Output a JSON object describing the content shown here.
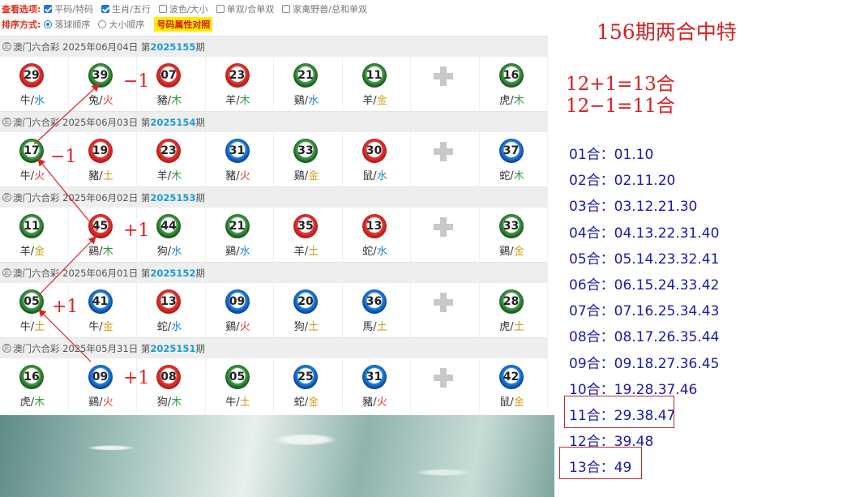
{
  "options": {
    "view_label": "查看选项:",
    "view_items": [
      {
        "label": "平码/特码",
        "checked": true
      },
      {
        "label": "生肖/五行",
        "checked": true
      },
      {
        "label": "波色/大小",
        "checked": false
      },
      {
        "label": "单双/合单双",
        "checked": false
      },
      {
        "label": "家禽野兽/总和单双",
        "checked": false
      }
    ],
    "sort_label": "排序方式:",
    "sort_items": [
      {
        "label": "落球顺序",
        "selected": true
      },
      {
        "label": "大小顺序",
        "selected": false
      }
    ],
    "highlight_button": "号码属性对照"
  },
  "draws": [
    {
      "prefix": "澳门六合彩 2025年06月04日 第",
      "issue": "2025155",
      "suffix": "期",
      "balls": [
        {
          "num": "29",
          "color": "red",
          "zodiac": "牛",
          "element": "水",
          "el": "water"
        },
        {
          "num": "39",
          "color": "green",
          "zodiac": "兔",
          "element": "火",
          "el": "fire"
        },
        {
          "num": "07",
          "color": "red",
          "zodiac": "豬",
          "element": "木",
          "el": "wood"
        },
        {
          "num": "23",
          "color": "red",
          "zodiac": "羊",
          "element": "木",
          "el": "wood"
        },
        {
          "num": "21",
          "color": "green",
          "zodiac": "鷄",
          "element": "水",
          "el": "water"
        },
        {
          "num": "11",
          "color": "green",
          "zodiac": "羊",
          "element": "金",
          "el": "gold"
        }
      ],
      "special": {
        "num": "16",
        "color": "green",
        "zodiac": "虎",
        "element": "木",
        "el": "wood"
      }
    },
    {
      "prefix": "澳门六合彩 2025年06月03日 第",
      "issue": "2025154",
      "suffix": "期",
      "balls": [
        {
          "num": "17",
          "color": "green",
          "zodiac": "牛",
          "element": "火",
          "el": "fire"
        },
        {
          "num": "19",
          "color": "red",
          "zodiac": "豬",
          "element": "土",
          "el": "earth"
        },
        {
          "num": "23",
          "color": "red",
          "zodiac": "羊",
          "element": "木",
          "el": "wood"
        },
        {
          "num": "31",
          "color": "blue",
          "zodiac": "豬",
          "element": "火",
          "el": "fire"
        },
        {
          "num": "33",
          "color": "green",
          "zodiac": "鷄",
          "element": "金",
          "el": "gold"
        },
        {
          "num": "30",
          "color": "red",
          "zodiac": "鼠",
          "element": "水",
          "el": "water"
        }
      ],
      "special": {
        "num": "37",
        "color": "blue",
        "zodiac": "蛇",
        "element": "木",
        "el": "wood"
      }
    },
    {
      "prefix": "澳门六合彩 2025年06月02日 第",
      "issue": "2025153",
      "suffix": "期",
      "balls": [
        {
          "num": "11",
          "color": "green",
          "zodiac": "羊",
          "element": "金",
          "el": "gold"
        },
        {
          "num": "45",
          "color": "red",
          "zodiac": "鷄",
          "element": "木",
          "el": "wood"
        },
        {
          "num": "44",
          "color": "green",
          "zodiac": "狗",
          "element": "水",
          "el": "water"
        },
        {
          "num": "21",
          "color": "green",
          "zodiac": "鷄",
          "element": "水",
          "el": "water"
        },
        {
          "num": "35",
          "color": "red",
          "zodiac": "羊",
          "element": "土",
          "el": "earth"
        },
        {
          "num": "13",
          "color": "red",
          "zodiac": "蛇",
          "element": "水",
          "el": "water"
        }
      ],
      "special": {
        "num": "33",
        "color": "green",
        "zodiac": "鷄",
        "element": "金",
        "el": "gold"
      }
    },
    {
      "prefix": "澳门六合彩 2025年06月01日 第",
      "issue": "2025152",
      "suffix": "期",
      "balls": [
        {
          "num": "05",
          "color": "green",
          "zodiac": "牛",
          "element": "土",
          "el": "earth"
        },
        {
          "num": "41",
          "color": "blue",
          "zodiac": "牛",
          "element": "金",
          "el": "gold"
        },
        {
          "num": "13",
          "color": "red",
          "zodiac": "蛇",
          "element": "水",
          "el": "water"
        },
        {
          "num": "09",
          "color": "blue",
          "zodiac": "鷄",
          "element": "火",
          "el": "fire"
        },
        {
          "num": "20",
          "color": "blue",
          "zodiac": "狗",
          "element": "土",
          "el": "earth"
        },
        {
          "num": "36",
          "color": "blue",
          "zodiac": "馬",
          "element": "土",
          "el": "earth"
        }
      ],
      "special": {
        "num": "28",
        "color": "green",
        "zodiac": "虎",
        "element": "土",
        "el": "earth"
      }
    },
    {
      "prefix": "澳门六合彩 2025年05月31日 第",
      "issue": "2025151",
      "suffix": "期",
      "balls": [
        {
          "num": "16",
          "color": "green",
          "zodiac": "虎",
          "element": "木",
          "el": "wood"
        },
        {
          "num": "09",
          "color": "blue",
          "zodiac": "鷄",
          "element": "火",
          "el": "fire"
        },
        {
          "num": "08",
          "color": "red",
          "zodiac": "狗",
          "element": "木",
          "el": "wood"
        },
        {
          "num": "05",
          "color": "green",
          "zodiac": "牛",
          "element": "土",
          "el": "earth"
        },
        {
          "num": "25",
          "color": "blue",
          "zodiac": "蛇",
          "element": "金",
          "el": "gold"
        },
        {
          "num": "31",
          "color": "blue",
          "zodiac": "豬",
          "element": "火",
          "el": "fire"
        }
      ],
      "special": {
        "num": "42",
        "color": "blue",
        "zodiac": "鼠",
        "element": "金",
        "el": "gold"
      }
    }
  ],
  "annotations": {
    "a1": "−1",
    "a2": "−1",
    "a3": "+1",
    "a4": "+1",
    "a5": "+1"
  },
  "right": {
    "title": "156期两合中特",
    "calc1": "12+1=13合",
    "calc2": "12−1=11合",
    "he_list": [
      "01合：01.10",
      "02合：02.11.20",
      "03合：03.12.21.30",
      "04合：04.13.22.31.40",
      "05合：05.14.23.32.41",
      "06合：06.15.24.33.42",
      "07合：07.16.25.34.43",
      "08合：08.17.26.35.44",
      "09合：09.18.27.36.45",
      "10合：19.28.37.46",
      "11合：29.38.47",
      "12合：39.48",
      "13合：49"
    ]
  }
}
